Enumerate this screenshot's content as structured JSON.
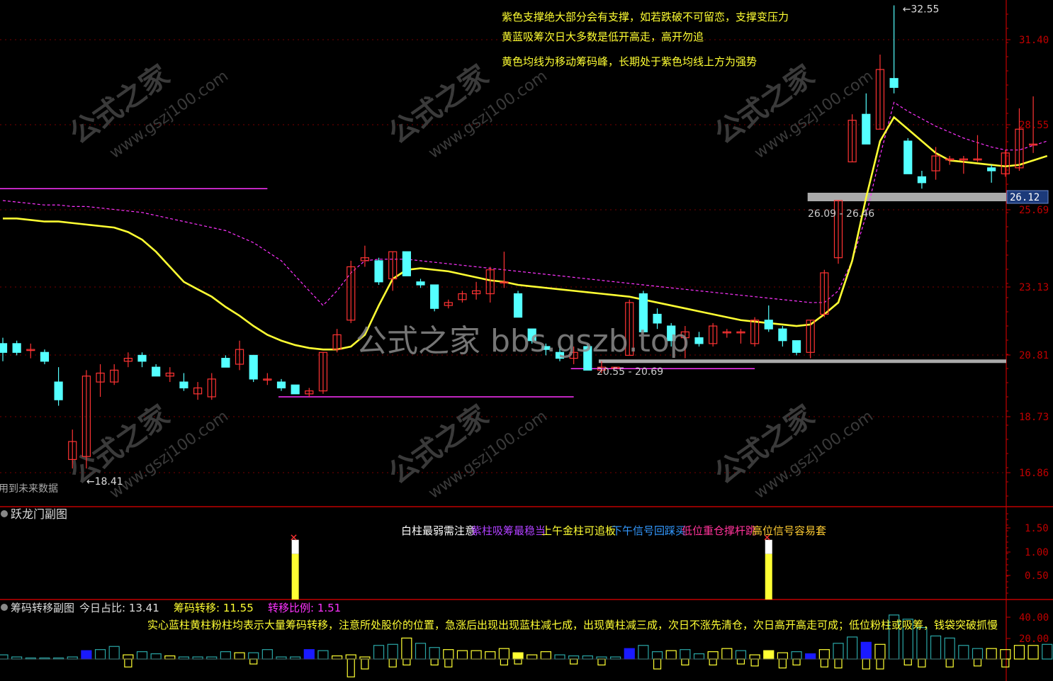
{
  "colors": {
    "up": "#ff3333",
    "down": "#54ffff",
    "ma_yellow": "#ffff33",
    "ma_purple": "#ff33ff",
    "support_gray": "#aaaaaa",
    "axis_red": "#c00000",
    "blue_bar": "#1a1aff",
    "teal_bar": "#2aa6a6",
    "white": "#ffffff",
    "watermark": "#777777"
  },
  "main_panel": {
    "notes": [
      "紫色支撑绝大部分会有支撑，如若跌破不可留恋，支撑变压力",
      "黄蓝吸筹次日大多数是低开高走，高开勿追",
      "黄色均线为移动筹码峰，长期处于紫色均线上方为强势"
    ],
    "future_data_label": "用到未来数据",
    "watermark_center": "公式之家 bbs.gszb.top",
    "watermark_tiles": [
      "公式之家",
      "www.gszj100.com"
    ],
    "high_marker": "32.55",
    "low_marker": "18.41",
    "current_price": "26.12",
    "support_label_upper": "26.09 - 26.46",
    "support_label_lower": "20.55 - 20.69"
  },
  "sub1": {
    "title": "跃龙门副图",
    "signal_texts": [
      {
        "text": "白柱最弱需注意",
        "color": "#ffffff"
      },
      {
        "text": "紫柱吸筹最稳当",
        "color": "#b040ff"
      },
      {
        "text": "上午金柱可追板",
        "color": "#ffff33"
      },
      {
        "text": "下午信号回踩买",
        "color": "#3399ff"
      },
      {
        "text": "低位重仓撑杆跳",
        "color": "#ff3399"
      },
      {
        "text": "高位信号容易套",
        "color": "#ffcc33"
      }
    ]
  },
  "sub2": {
    "title": "筹码转移副图",
    "stats": [
      {
        "label": "今日占比:",
        "value": "13.41",
        "color": "#dddddd"
      },
      {
        "label": "筹码转移:",
        "value": "11.55",
        "color": "#ffff33"
      },
      {
        "label": "转移比例:",
        "value": "1.51",
        "color": "#ff33ff"
      }
    ],
    "note": "实心蓝柱黄柱粉柱均表示大量筹码转移，注意所处股价的位置，急涨后出现出现蓝柱减七成，出现黄柱减三成，次日不涨先清仓，次日高开高走可成；低位粉柱或吸筹，钱袋突破抓慢"
  },
  "chart_data": [
    {
      "type": "candlestick",
      "y_ticks": [
        "31.40",
        "28.55",
        "25.69",
        "23.13",
        "20.81",
        "18.73",
        "16.86"
      ],
      "ylim": [
        16.0,
        33.0
      ],
      "candles": [
        [
          21.2,
          21.4,
          20.6,
          20.9
        ],
        [
          21.2,
          21.3,
          20.8,
          20.9
        ],
        [
          21.0,
          21.2,
          20.7,
          21.0
        ],
        [
          20.9,
          21.0,
          20.5,
          20.6
        ],
        [
          19.9,
          20.4,
          19.1,
          19.3
        ],
        [
          17.3,
          18.3,
          17.0,
          17.9
        ],
        [
          17.4,
          20.3,
          17.0,
          20.1
        ],
        [
          19.9,
          20.5,
          19.4,
          20.2
        ],
        [
          19.9,
          20.5,
          19.8,
          20.3
        ],
        [
          20.6,
          20.9,
          20.4,
          20.7
        ],
        [
          20.8,
          20.9,
          20.4,
          20.6
        ],
        [
          20.4,
          20.5,
          20.1,
          20.1
        ],
        [
          20.1,
          20.4,
          19.9,
          20.2
        ],
        [
          19.9,
          20.2,
          19.6,
          19.7
        ],
        [
          19.5,
          19.9,
          19.3,
          19.7
        ],
        [
          19.4,
          20.2,
          19.3,
          20.0
        ],
        [
          20.7,
          20.8,
          20.4,
          20.4
        ],
        [
          20.5,
          21.3,
          20.3,
          21.0
        ],
        [
          20.8,
          20.8,
          19.9,
          20.0
        ],
        [
          20.0,
          20.2,
          19.8,
          20.0
        ],
        [
          19.9,
          20.0,
          19.6,
          19.7
        ],
        [
          19.8,
          19.8,
          19.5,
          19.5
        ],
        [
          19.5,
          19.7,
          19.4,
          19.6
        ],
        [
          19.6,
          20.9,
          19.5,
          20.9
        ],
        [
          21.0,
          21.7,
          20.9,
          21.5
        ],
        [
          22.0,
          24.0,
          21.9,
          23.8
        ],
        [
          24.0,
          24.5,
          23.8,
          24.1
        ],
        [
          24.0,
          24.1,
          23.2,
          23.3
        ],
        [
          23.4,
          24.3,
          23.0,
          24.3
        ],
        [
          24.3,
          24.3,
          23.5,
          23.5
        ],
        [
          23.3,
          23.4,
          23.1,
          23.2
        ],
        [
          23.2,
          23.2,
          22.3,
          22.4
        ],
        [
          22.5,
          22.7,
          22.4,
          22.6
        ],
        [
          22.7,
          23.0,
          22.6,
          22.9
        ],
        [
          22.9,
          23.3,
          22.7,
          23.0
        ],
        [
          22.9,
          23.8,
          22.6,
          23.7
        ],
        [
          23.3,
          24.3,
          23.1,
          23.3
        ],
        [
          22.9,
          23.0,
          22.1,
          22.1
        ],
        [
          21.7,
          21.7,
          21.2,
          21.3
        ],
        [
          21.1,
          21.2,
          20.8,
          21.0
        ],
        [
          20.9,
          21.1,
          20.6,
          20.7
        ],
        [
          20.7,
          21.1,
          20.5,
          20.9
        ],
        [
          21.1,
          21.2,
          20.3,
          20.3
        ],
        [
          20.3,
          20.6,
          20.2,
          20.4
        ],
        [
          20.4,
          20.4,
          20.4,
          20.4
        ],
        [
          20.8,
          22.7,
          20.8,
          22.6
        ],
        [
          22.9,
          23.0,
          21.6,
          21.6
        ],
        [
          22.2,
          22.4,
          21.7,
          21.9
        ],
        [
          21.8,
          21.9,
          21.1,
          21.3
        ],
        [
          21.4,
          21.8,
          20.7,
          21.6
        ],
        [
          21.4,
          21.6,
          21.1,
          21.2
        ],
        [
          21.2,
          21.9,
          21.1,
          21.8
        ],
        [
          21.6,
          21.7,
          21.4,
          21.6
        ],
        [
          21.6,
          21.7,
          21.2,
          21.6
        ],
        [
          21.2,
          22.1,
          21.1,
          22.0
        ],
        [
          22.0,
          22.5,
          21.6,
          21.7
        ],
        [
          21.7,
          21.8,
          21.1,
          21.3
        ],
        [
          21.3,
          21.3,
          20.8,
          20.9
        ],
        [
          20.9,
          22.0,
          20.7,
          22.0
        ],
        [
          22.2,
          23.7,
          22.1,
          23.6
        ],
        [
          24.1,
          26.0,
          23.9,
          26.0
        ],
        [
          27.3,
          28.9,
          27.3,
          28.7
        ],
        [
          28.9,
          29.6,
          27.9,
          27.9
        ],
        [
          28.4,
          30.9,
          28.4,
          30.4
        ],
        [
          30.1,
          32.55,
          29.6,
          29.8
        ],
        [
          28.0,
          28.1,
          26.9,
          26.9
        ],
        [
          26.8,
          27.0,
          26.4,
          26.6
        ],
        [
          27.0,
          27.8,
          26.7,
          27.5
        ],
        [
          27.4,
          27.5,
          27.2,
          27.4
        ],
        [
          27.4,
          27.5,
          26.9,
          27.4
        ],
        [
          27.4,
          28.2,
          27.3,
          27.4
        ],
        [
          27.1,
          27.2,
          26.6,
          27.0
        ],
        [
          26.9,
          27.7,
          26.8,
          27.6
        ],
        [
          27.1,
          29.1,
          27.0,
          28.4
        ],
        [
          27.9,
          29.5,
          27.6,
          27.9
        ]
      ],
      "ma_yellow": [
        25.4,
        25.4,
        25.35,
        25.3,
        25.3,
        25.25,
        25.2,
        25.15,
        25.1,
        24.95,
        24.7,
        24.3,
        23.8,
        23.3,
        23.05,
        22.8,
        22.45,
        22.15,
        21.8,
        21.5,
        21.3,
        21.15,
        21.05,
        21.0,
        21.0,
        21.1,
        21.5,
        22.5,
        23.4,
        23.7,
        23.75,
        23.7,
        23.65,
        23.55,
        23.45,
        23.35,
        23.3,
        23.2,
        23.15,
        23.1,
        23.05,
        23.0,
        22.95,
        22.9,
        22.85,
        22.8,
        22.7,
        22.6,
        22.5,
        22.4,
        22.3,
        22.2,
        22.1,
        22.0,
        21.95,
        21.9,
        21.85,
        21.8,
        21.85,
        22.2,
        22.6,
        24.0,
        26.1,
        28.0,
        28.8,
        28.4,
        28.0,
        27.6,
        27.35,
        27.3,
        27.25,
        27.2,
        27.15,
        27.2,
        27.35,
        27.5
      ],
      "ma_purple": [
        26.0,
        25.95,
        25.9,
        25.85,
        25.85,
        25.8,
        25.8,
        25.75,
        25.7,
        25.65,
        25.6,
        25.5,
        25.4,
        25.3,
        25.2,
        25.1,
        25.0,
        24.8,
        24.6,
        24.3,
        24.0,
        23.5,
        23.0,
        22.5,
        23.0,
        23.6,
        24.0,
        24.05,
        24.05,
        24.05,
        24.0,
        23.95,
        23.9,
        23.85,
        23.8,
        23.75,
        23.7,
        23.65,
        23.6,
        23.55,
        23.5,
        23.45,
        23.4,
        23.35,
        23.3,
        23.25,
        23.2,
        23.15,
        23.1,
        23.05,
        23.0,
        22.95,
        22.9,
        22.85,
        22.8,
        22.75,
        22.7,
        22.65,
        22.6,
        22.6,
        23.0,
        24.0,
        25.5,
        27.5,
        29.3,
        29.0,
        28.75,
        28.5,
        28.3,
        28.1,
        27.95,
        27.8,
        27.7,
        27.7,
        27.85,
        28.0
      ],
      "support_lines": [
        {
          "from": 0,
          "to": 19,
          "price": 26.4,
          "color": "#ff33ff"
        },
        {
          "from": 20,
          "to": 41,
          "price": 19.4,
          "color": "#ff33ff"
        },
        {
          "from": 41,
          "to": 54,
          "price": 20.35,
          "color": "#ff33ff"
        },
        {
          "from": 58,
          "to": 75,
          "price": 26.12,
          "color": "#aaaaaa"
        },
        {
          "from": 43,
          "to": 75,
          "price": 20.6,
          "color": "#aaaaaa"
        }
      ],
      "high": {
        "index": 64,
        "price": 32.55
      },
      "low": {
        "index": 6,
        "price": 17.0
      }
    },
    {
      "type": "bar",
      "name_ref": "跃龙门副图",
      "y_ticks": [
        "1.50",
        "1.00",
        "0.50"
      ],
      "ylim": [
        0,
        1.6
      ],
      "signals": [
        {
          "index": 21,
          "value": 1.4
        },
        {
          "index": 55,
          "value": 1.4
        }
      ]
    },
    {
      "type": "bar",
      "name_ref": "筹码转移副图",
      "y_ticks": [
        "40.00",
        "20.00"
      ],
      "ylim": [
        -20,
        55
      ],
      "values": [
        4,
        2,
        1,
        1,
        1,
        2,
        8,
        9,
        12,
        4,
        7,
        5,
        3,
        2,
        2,
        2,
        7,
        6,
        6,
        9,
        2,
        2,
        9,
        8,
        3,
        4,
        2,
        13,
        14,
        20,
        15,
        11,
        9,
        8,
        8,
        7,
        10,
        6,
        4,
        7,
        4,
        3,
        3,
        2,
        2,
        10,
        13,
        7,
        8,
        9,
        5,
        7,
        10,
        8,
        4,
        8,
        6,
        7,
        5,
        9,
        15,
        21,
        16,
        14,
        42,
        38,
        30,
        22,
        20,
        13,
        10,
        10,
        9,
        13,
        13,
        14
      ],
      "negatives": [
        0,
        0,
        0,
        0,
        0,
        0,
        0,
        0,
        0,
        -8,
        0,
        0,
        0,
        0,
        0,
        0,
        0,
        0,
        -5,
        0,
        0,
        0,
        0,
        0,
        0,
        -18,
        -10,
        0,
        -8,
        -6,
        0,
        -6,
        -8,
        0,
        0,
        0,
        -6,
        -5,
        0,
        0,
        0,
        -5,
        0,
        -6,
        0,
        0,
        0,
        -10,
        0,
        -6,
        0,
        -6,
        0,
        -5,
        -7,
        0,
        -9,
        -6,
        0,
        -8,
        -9,
        0,
        -10,
        -10,
        0,
        -6,
        -8,
        0,
        -8,
        0,
        -7,
        0,
        -8,
        0,
        0,
        0
      ],
      "colors_code": "ttttttbttyttyttttyttttbtyyyttyttyyyyyyyytttttbttyttyytyyytbyttbytttttttyyyy"
    }
  ]
}
